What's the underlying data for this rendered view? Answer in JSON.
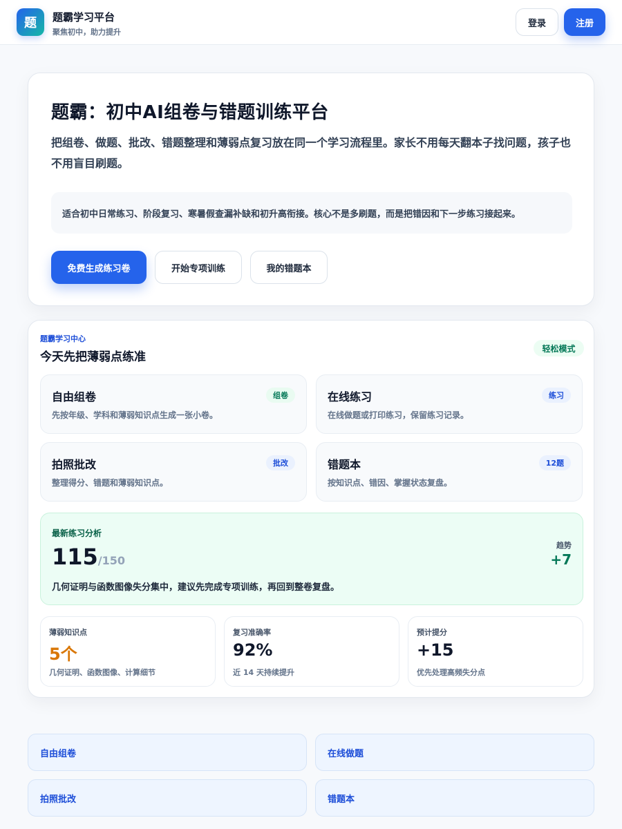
{
  "header": {
    "logo_text": "题",
    "brand_title": "题霸学习平台",
    "brand_subtitle": "聚焦初中，助力提升",
    "login_label": "登录",
    "register_label": "注册"
  },
  "hero": {
    "title": "题霸：初中AI组卷与错题训练平台",
    "description": "把组卷、做题、批改、错题整理和薄弱点复习放在同一个学习流程里。家长不用每天翻本子找问题，孩子也不用盲目刷题。",
    "note": "适合初中日常练习、阶段复习、寒暑假查漏补缺和初升高衔接。核心不是多刷题，而是把错因和下一步练习接起来。",
    "buttons": {
      "generate": "免费生成练习卷",
      "training": "开始专项训练",
      "mistakes": "我的错题本"
    }
  },
  "center": {
    "kicker": "题霸学习中心",
    "title": "今天先把薄弱点练准",
    "mode_badge": "轻松模式",
    "features": [
      {
        "title": "自由组卷",
        "tag": "组卷",
        "desc": "先按年级、学科和薄弱知识点生成一张小卷。"
      },
      {
        "title": "在线练习",
        "tag": "练习",
        "desc": "在线做题或打印练习，保留练习记录。"
      },
      {
        "title": "拍照批改",
        "tag": "批改",
        "desc": "整理得分、错题和薄弱知识点。"
      },
      {
        "title": "错题本",
        "tag": "12题",
        "desc": "按知识点、错因、掌握状态复盘。"
      }
    ],
    "analysis": {
      "label": "最新练习分析",
      "score": "115",
      "total": "/150",
      "trend_label": "趋势",
      "trend_value": "+7",
      "note": "几何证明与函数图像失分集中，建议先完成专项训练，再回到整卷复盘。"
    },
    "stats": [
      {
        "label": "薄弱知识点",
        "value": "5个",
        "desc": "几何证明、函数图像、计算细节"
      },
      {
        "label": "复习准确率",
        "value": "92%",
        "desc": "近 14 天持续提升"
      },
      {
        "label": "预计提分",
        "value": "+15",
        "desc": "优先处理高频失分点"
      }
    ]
  },
  "links": [
    "自由组卷",
    "在线做题",
    "拍照批改",
    "错题本"
  ],
  "colors": {
    "primary": "#2563eb",
    "success": "#047857",
    "warning": "#d97706"
  }
}
